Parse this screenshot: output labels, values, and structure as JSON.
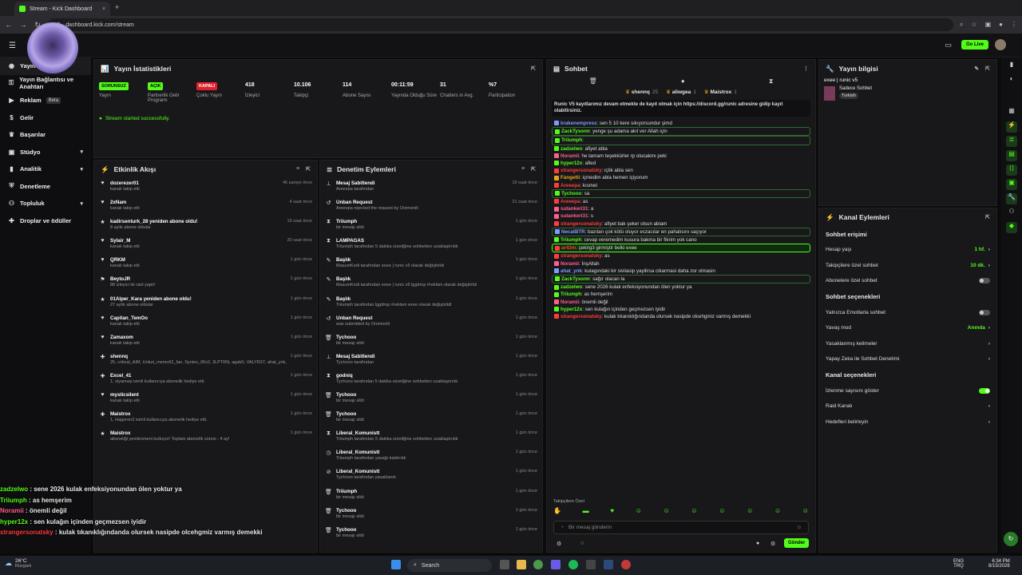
{
  "browser": {
    "tab_title": "Stream - Kick Dashboard",
    "url": "dashboard.kick.com/stream"
  },
  "header": {
    "live_label": "Go Live"
  },
  "sidebar": {
    "items": [
      {
        "label": "Yayın",
        "icon": "broadcast-icon"
      },
      {
        "label": "Yayın Bağlantısı ve Anahtarı",
        "icon": "key-icon"
      },
      {
        "label": "Reklam",
        "badge": "Beta",
        "icon": "megaphone-icon"
      },
      {
        "label": "Gelir",
        "icon": "money-icon"
      },
      {
        "label": "Başarılar",
        "icon": "trophy-icon"
      },
      {
        "label": "Stüdyo",
        "icon": "studio-icon",
        "chev": "v"
      },
      {
        "label": "Analitik",
        "icon": "analytics-icon",
        "chev": "v"
      },
      {
        "label": "Denetleme",
        "icon": "shield-icon"
      },
      {
        "label": "Topluluk",
        "icon": "community-icon",
        "chev": "v"
      },
      {
        "label": "Droplar ve ödüller",
        "icon": "gift-icon"
      }
    ]
  },
  "stats_panel": {
    "title": "Yayın İstatistikleri",
    "success": "Stream started successfully.",
    "items": [
      {
        "value": "SORUNSUZ",
        "label": "Yayın",
        "color": "#53fc18"
      },
      {
        "value": "AÇIK",
        "label": "Partnerlik Gelir Programı",
        "color": "#53fc18"
      },
      {
        "value": "KAPALI",
        "label": "Çoklu Yayın",
        "color": "#e0202a"
      },
      {
        "value": "418",
        "label": "İzleyici"
      },
      {
        "value": "10.106",
        "label": "Takipçi"
      },
      {
        "value": "114",
        "label": "Abone Sayısı"
      },
      {
        "value": "00:11:59",
        "label": "Yayında Olduğu Süre"
      },
      {
        "value": "31",
        "label": "Chatters in Avg."
      },
      {
        "value": "%7",
        "label": "Participation"
      }
    ]
  },
  "activity": {
    "title": "Etkinlik Akışı",
    "rows": [
      {
        "icon": "heart-icon",
        "name": "dozerezer01",
        "sub": "kanalı takip etti",
        "time": "46 saniye önce"
      },
      {
        "icon": "heart-icon",
        "name": "2xNam",
        "sub": "kanalı takip etti",
        "time": "4 saat önce"
      },
      {
        "icon": "star-icon",
        "name": "kadirsenturk_28 yeniden abone oldu!",
        "sub": "8 aylık abone oldular",
        "time": "19 saat önce"
      },
      {
        "icon": "heart-icon",
        "name": "Sylair_M",
        "sub": "kanalı takip etti",
        "time": "20 saat önce"
      },
      {
        "icon": "heart-icon",
        "name": "QRKM",
        "sub": "kanalı takip etti",
        "time": "1 gün önce"
      },
      {
        "icon": "raid-icon",
        "name": "BeytoJR",
        "sub": "88 izleyici ile raid yaptı!",
        "time": "1 gün önce"
      },
      {
        "icon": "star-icon",
        "name": "01Alper_Kara yeniden abone oldu!",
        "sub": "27 aylık abone oldular",
        "time": "1 gün önce"
      },
      {
        "icon": "heart-icon",
        "name": "Capitan_TemOo",
        "sub": "kanalı takip etti",
        "time": "1 gün önce"
      },
      {
        "icon": "heart-icon",
        "name": "Zamaxom",
        "sub": "kanalı takip etti",
        "time": "1 gün önce"
      },
      {
        "icon": "gift-icon",
        "name": "shennq",
        "sub": "25, critical_AIM, Unkot_memo62_fan, Syntex_06v2, 3LPTRN, agab0, VALYR37, ahat_ynk, Triiumph ...",
        "time": "1 gün önce"
      },
      {
        "icon": "gift-icon",
        "name": "Excel_41",
        "sub": "1, slyamsip isimli kullanıcıya abonelik hediye etti.",
        "time": "1 gün önce"
      },
      {
        "icon": "heart-icon",
        "name": "mysticsilent",
        "sub": "kanalı takip etti",
        "time": "1 gün önce"
      },
      {
        "icon": "gift-icon",
        "name": "Maistrox",
        "sub": "1, Hageron3 isimli kullanıcıya abonelik hediye etti.",
        "time": "1 gün önce"
      },
      {
        "icon": "star-icon",
        "name": "Maistrox",
        "sub": "aboneliği yenilenmeni kutluyor! Toplam abonelik süresi - 4 ay!",
        "time": "1 gün önce"
      }
    ]
  },
  "moderation": {
    "title": "Denetim Eylemleri",
    "rows": [
      {
        "icon": "pin-icon",
        "name": "Mesaj Sabitlendi",
        "sub": "Areeepa tarafından",
        "time": "19 saat önce"
      },
      {
        "icon": "undo-icon",
        "name": "Unban Request",
        "sub": "Areeepa rejected the request by Onimonili",
        "time": "21 saat önce"
      },
      {
        "icon": "hourglass-icon",
        "name": "Triiumph",
        "sub": "bir mesajı sildi",
        "time": "1 gün önce"
      },
      {
        "icon": "hourglass-icon",
        "name": "LAMPAGAS",
        "sub": "Triiumph tarafından 5 dakika süreliğine sohbetten uzaklaştırıldı",
        "time": "1 gün önce"
      },
      {
        "icon": "edit-icon",
        "name": "Başlık",
        "sub": "MasumKedi tarafından exee | runic v5 olarak değiştirildi",
        "time": "1 gün önce"
      },
      {
        "icon": "edit-icon",
        "name": "Başlık",
        "sub": "MasumKedi tarafından exee | runic v5 lggdrop #reklam olarak değiştirildi",
        "time": "1 gün önce"
      },
      {
        "icon": "edit-icon",
        "name": "Başlık",
        "sub": "Triiumph tarafından lggdrop #reklam exee olarak değiştirildi",
        "time": "1 gün önce"
      },
      {
        "icon": "undo-icon",
        "name": "Unban Request",
        "sub": "was submitted by Onimonili",
        "time": "1 gün önce"
      },
      {
        "icon": "trash-icon",
        "name": "Tychooo",
        "sub": "bir mesajı sildi",
        "time": "1 gün önce"
      },
      {
        "icon": "pin-icon",
        "name": "Mesaj Sabitlendi",
        "sub": "Tychooo tarafından",
        "time": "1 gün önce"
      },
      {
        "icon": "hourglass-icon",
        "name": "godniq",
        "sub": "Tychooo tarafından 5 dakika süreliğine sohbetten uzaklaştırıldı",
        "time": "1 gün önce"
      },
      {
        "icon": "trash-icon",
        "name": "Tychooo",
        "sub": "bir mesajı sildi",
        "time": "1 gün önce"
      },
      {
        "icon": "trash-icon",
        "name": "Tychooo",
        "sub": "bir mesajı sildi",
        "time": "1 gün önce"
      },
      {
        "icon": "hourglass-icon",
        "name": "Liberal_Komunistt",
        "sub": "Triiumph tarafından 5 dakika süreliğine sohbetten uzaklaştırıldı",
        "time": "1 gün önce"
      },
      {
        "icon": "clock-icon",
        "name": "Liberal_Komunistt",
        "sub": "Triiumph tarafından yasağı kaldırıldı",
        "time": "1 gün önce"
      },
      {
        "icon": "ban-icon",
        "name": "Liberal_Komunistt",
        "sub": "Tychooo tarafından yasaklandı",
        "time": "1 gün önce"
      },
      {
        "icon": "trash-icon",
        "name": "Triiumph",
        "sub": "bir mesajı sildi",
        "time": "1 gün önce"
      },
      {
        "icon": "trash-icon",
        "name": "Tychooo",
        "sub": "bir mesajı sildi",
        "time": "1 gün önce"
      },
      {
        "icon": "trash-icon",
        "name": "Tychooo",
        "sub": "bir mesajı sildi",
        "time": "1 gün önce"
      }
    ]
  },
  "chat": {
    "title": "Sohbet",
    "tops": [
      {
        "name": "shennq",
        "n": "25"
      },
      {
        "name": "aliwgea",
        "n": "1"
      },
      {
        "name": "Maistrox",
        "n": "1"
      }
    ],
    "pinned": "Runic V5 kayıtlarımız devam etmekte de kayıt olmak için https://discord.gg/runic adresine gidip kayıt olabilirsiniz.",
    "messages": [
      {
        "u": "krakenempress",
        "c": "#7a9cff",
        "t": "sen 5 10 kere sıkıyorsundur şimd"
      },
      {
        "u": "ZackTysonn",
        "c": "#53fc18",
        "t": "yenge şu adama akıl ver Allah için",
        "cls": "hl"
      },
      {
        "u": "Triiumph",
        "c": "#53fc18",
        "t": "",
        "cls": "hl"
      },
      {
        "u": "zadzelwo",
        "c": "#53fc18",
        "t": "afiyet abla"
      },
      {
        "u": "Noramii",
        "c": "#ff5e8a",
        "t": "he tamam teşekkürler rp olucakmı peki"
      },
      {
        "u": "hyper12x",
        "c": "#53fc18",
        "t": "afied"
      },
      {
        "u": "strangersonatsky",
        "c": "#ff3b3b",
        "t": "içtik abla sen"
      },
      {
        "u": "Fangetti",
        "c": "#e6a21c",
        "t": "içmedim abla hemen içiyorum"
      },
      {
        "u": "Areeepa",
        "c": "#ff3b3b",
        "t": "kısmet"
      },
      {
        "u": "Tychooo",
        "c": "#53fc18",
        "t": "sa",
        "cls": "hl"
      },
      {
        "u": "Areeepa",
        "c": "#ff3b3b",
        "t": "as"
      },
      {
        "u": "sutankeri31",
        "c": "#ff5e8a",
        "t": "a"
      },
      {
        "u": "sutankeri31",
        "c": "#ff5e8a",
        "t": "s"
      },
      {
        "u": "strangersonatsky",
        "c": "#ff3b3b",
        "t": "afiyet bak şeker olsun abiam"
      },
      {
        "u": "NecatBTR",
        "c": "#7a9cff",
        "t": "bazıları çok kötü oluyor eczacılar en pahalısını saçıyor",
        "cls": "hl"
      },
      {
        "u": "Triiumph",
        "c": "#53fc18",
        "t": "cevap veremedim kusura bakma bir fikrim yok cano"
      },
      {
        "u": "ar43m",
        "c": "#ff3b3b",
        "t": "çekirg3 girmiştir belki exee",
        "cls": "hl2"
      },
      {
        "u": "strangersonatsky",
        "c": "#ff3b3b",
        "t": "as"
      },
      {
        "u": "Noramii",
        "c": "#ff5e8a",
        "t": "İnşAllah"
      },
      {
        "u": "ahat_ynk",
        "c": "#7a9cff",
        "t": "kulagındaki kir sivilasip yayilirsa cikarmasi daha zor olmasin"
      },
      {
        "u": "ZackTysonn",
        "c": "#53fc18",
        "t": "sağır olacan la",
        "cls": "hl"
      },
      {
        "u": "zadzelwo",
        "c": "#53fc18",
        "t": "sene 2026 kulak enfeksiyonundan ölen yoktur ya"
      },
      {
        "u": "Triiumph",
        "c": "#53fc18",
        "t": "as hemşerim"
      },
      {
        "u": "Noramii",
        "c": "#ff5e8a",
        "t": "önemli değil"
      },
      {
        "u": "hyper12x",
        "c": "#53fc18",
        "t": "sen kulağın içinden geçmezsen iyidir"
      },
      {
        "u": "strangersonatsky",
        "c": "#ff3b3b",
        "t": "kulak tıkanıklığındanda olursek nasipde olcehgmiz varmış demekki"
      }
    ],
    "footer_label": "Takipçilere Özel",
    "input_placeholder": "Bir mesaj gönderin",
    "send_label": "Gönder"
  },
  "stream_info": {
    "title": "Yayın bilgisi",
    "stream_title": "exee | runic v5",
    "category": "Sadece Sohbet",
    "tag": "Turkish"
  },
  "channel_actions": {
    "title": "Kanal Eylemleri",
    "chat_access": "Sohbet erişimi",
    "rows1": [
      {
        "label": "Hesap yaşı",
        "value": "1 hf."
      },
      {
        "label": "Takipçilere özel sohbet",
        "value": "10 dk."
      },
      {
        "label": "Abonelere özel sohbet",
        "toggle": "off"
      }
    ],
    "chat_options": "Sohbet seçenekleri",
    "rows2": [
      {
        "label": "Yalnızca Emotlarla sohbet",
        "toggle": "off"
      },
      {
        "label": "Yavaş mod",
        "value": "Anında"
      },
      {
        "label": "Yasaklanmış kelimeler",
        "value": ""
      },
      {
        "label": "Yapay Zeka ile Sohbet Denetimi",
        "value": ""
      }
    ],
    "channel_options": "Kanal seçenekleri",
    "rows3": [
      {
        "label": "İzlenme sayısını göster",
        "toggle": "on"
      },
      {
        "label": "Raid Kanalı",
        "value": ""
      },
      {
        "label": "Hedefleri belirleyin",
        "value": ""
      }
    ]
  },
  "overlay": [
    {
      "u": "zadzelwo",
      "c": "#53fc18",
      "t": "sene 2026 kulak enfeksiyonundan ölen yoktur ya"
    },
    {
      "u": "Triiumph",
      "c": "#53fc18",
      "t": "as hemşerim"
    },
    {
      "u": "Noramii",
      "c": "#ff5e8a",
      "t": "önemli değil"
    },
    {
      "u": "hyper12x",
      "c": "#53fc18",
      "t": "sen kulağın içinden geçmezsen iyidir"
    },
    {
      "u": "strangersonatsky",
      "c": "#ff3b3b",
      "t": "kulak tıkanıklığındanda olursek nasipde olcehgmiz varmış demekki"
    }
  ],
  "taskbar": {
    "weather": "26°C",
    "weather_sub": "Rüzgarlı",
    "search": "Search",
    "lang": "ENG",
    "lang_sub": "TRQ",
    "time": "6:34 PM",
    "date": "8/15/2026"
  }
}
